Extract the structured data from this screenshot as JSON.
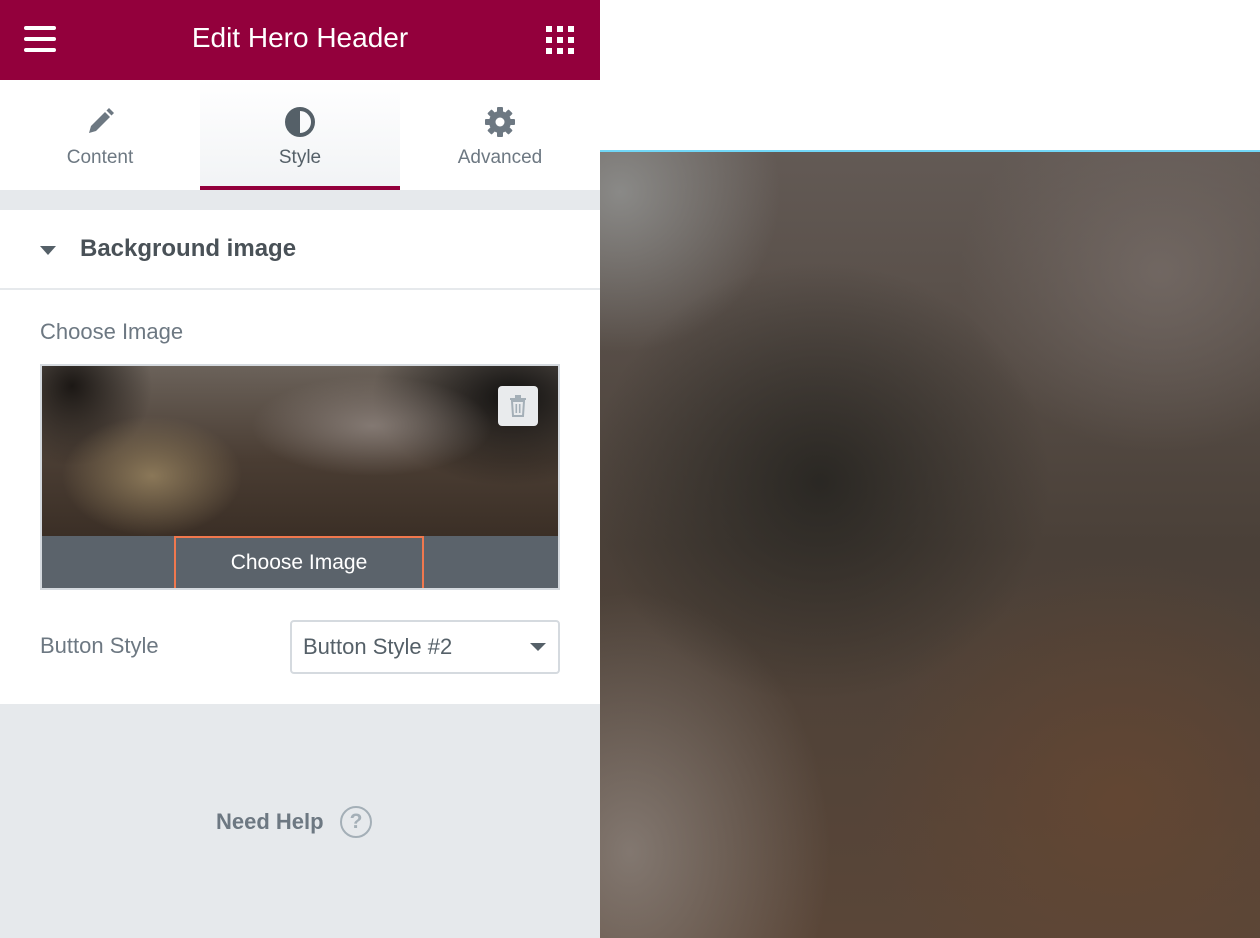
{
  "header": {
    "title": "Edit Hero Header",
    "menu_icon": "hamburger-menu-icon",
    "apps_icon": "grid-apps-icon",
    "background": "#93003c"
  },
  "tabs": [
    {
      "label": "Content",
      "icon": "pencil-icon",
      "active": false
    },
    {
      "label": "Style",
      "icon": "contrast-half-circle-icon",
      "active": true
    },
    {
      "label": "Advanced",
      "icon": "gear-icon",
      "active": false
    }
  ],
  "section": {
    "title": "Background image",
    "expanded": true,
    "choose_image_label": "Choose Image",
    "choose_image_button": "Choose Image",
    "delete_icon": "trash-icon",
    "button_style_label": "Button Style",
    "button_style_value": "Button Style #2"
  },
  "help": {
    "label": "Need Help",
    "icon": "question-circle-icon"
  },
  "colors": {
    "accent": "#93003c",
    "focus_border": "#f0784e",
    "preview_line": "#71d7f7"
  }
}
